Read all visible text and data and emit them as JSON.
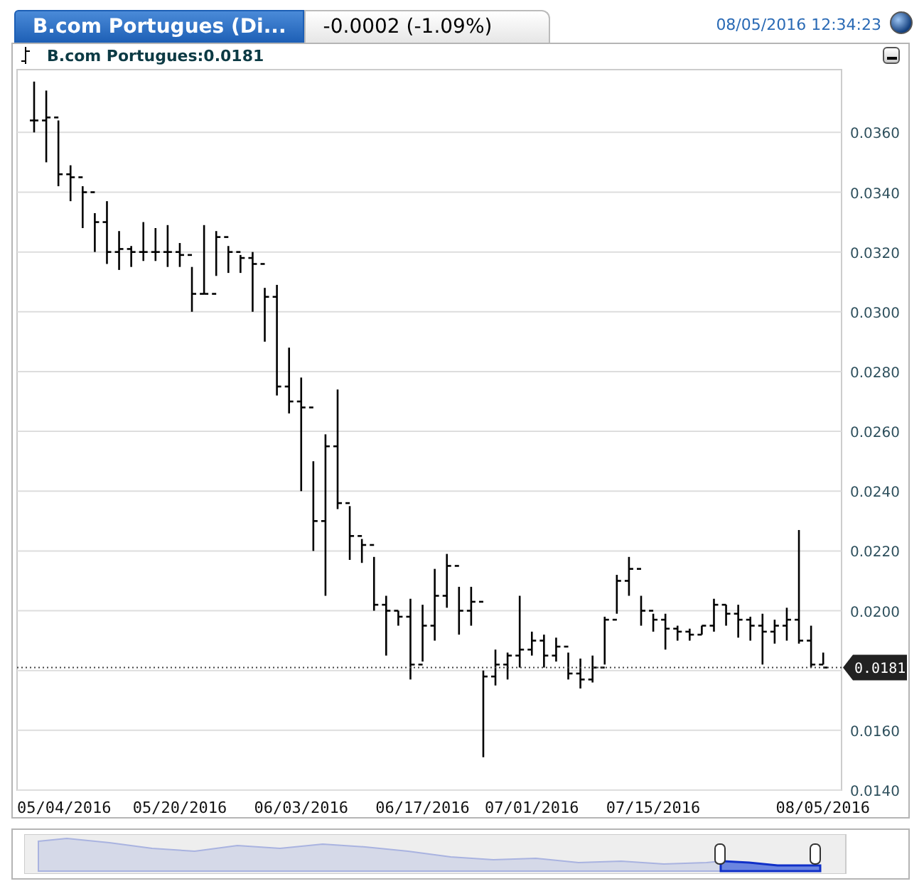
{
  "tabs": [
    {
      "label": "B.com Portugues (Di...",
      "selected": true
    },
    {
      "label": "-0.0002 (-1.09%)",
      "selected": false
    }
  ],
  "timestamp": "08/05/2016 12:34:23",
  "legend": {
    "text": "B.com Portugues:0.0181"
  },
  "price_tag": {
    "text": "0.0181"
  },
  "y_axis_labels": [
    "0.0360",
    "0.0340",
    "0.0320",
    "0.0300",
    "0.0280",
    "0.0260",
    "0.0240",
    "0.0220",
    "0.0200",
    "0.0160",
    "0.0140"
  ],
  "x_axis_labels": [
    "05/04/2016",
    "05/20/2016",
    "06/03/2016",
    "06/17/2016",
    "07/01/2016",
    "07/15/2016",
    "08/05/2016"
  ]
}
